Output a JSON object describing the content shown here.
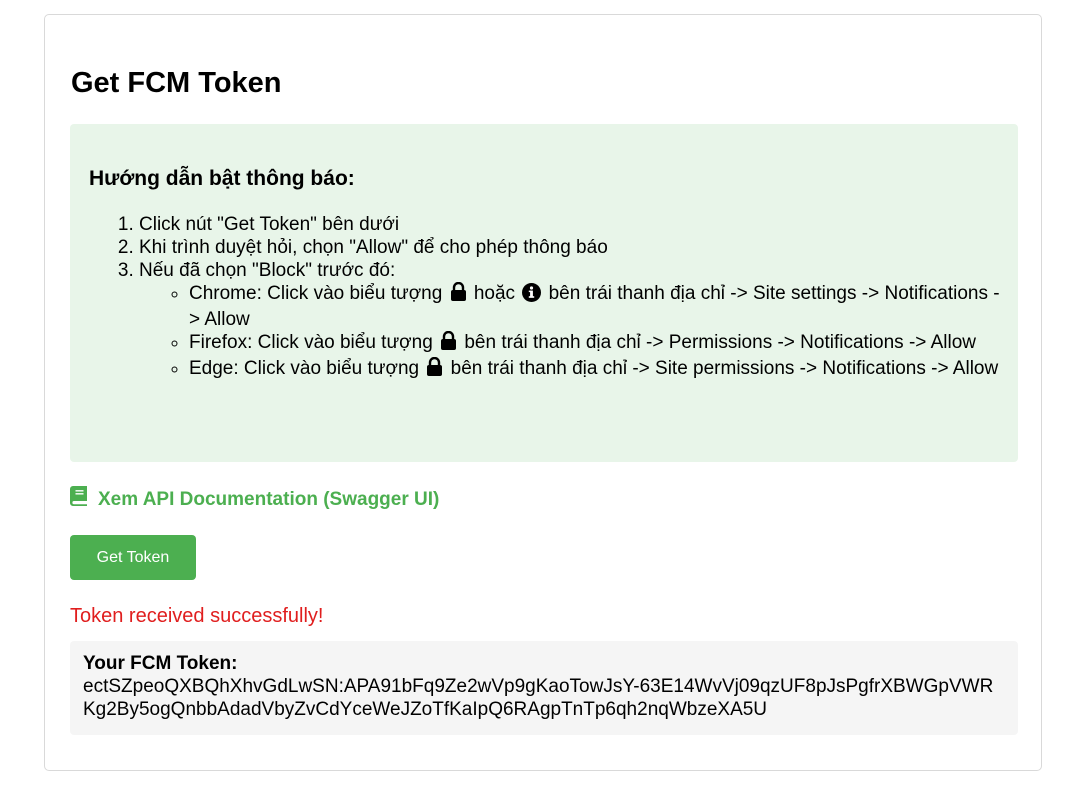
{
  "page": {
    "title": "Get FCM Token"
  },
  "guide": {
    "heading": "Hướng dẫn bật thông báo:",
    "step1": "Click nút \"Get Token\" bên dưới",
    "step2": "Khi trình duyệt hỏi, chọn \"Allow\" để cho phép thông báo",
    "step3": "Nếu đã chọn \"Block\" trước đó:",
    "chrome": {
      "before": "Chrome: Click vào biểu tượng",
      "middle": "hoặc",
      "after": "bên trái thanh địa chỉ -> Site settings -> Notifications -> Allow"
    },
    "firefox": {
      "before": "Firefox: Click vào biểu tượng",
      "after": "bên trái thanh địa chỉ -> Permissions -> Notifications -> Allow"
    },
    "edge": {
      "before": "Edge: Click vào biểu tượng",
      "after": "bên trái thanh địa chỉ -> Site permissions -> Notifications -> Allow"
    }
  },
  "doc_link": {
    "label": "Xem API Documentation (Swagger UI)",
    "icon": "book-icon"
  },
  "get_token_button": {
    "label": "Get Token"
  },
  "status": {
    "message": "Token received successfully!"
  },
  "token": {
    "label": "Your FCM Token:",
    "value": "ectSZpeoQXBQhXhvGdLwSN:APA91bFq9Ze2wVp9gKaoTowJsY-63E14WvVj09qzUF8pJsPgfrXBWGpVWRKg2By5ogQnbbAdadVbyZvCdYceWeJZoTfKaIpQ6RAgpTnTp6qh2nqWbzeXA5U"
  },
  "colors": {
    "accent": "#4caf50",
    "guide_bg": "#e8f5e9",
    "status": "#e01e1e",
    "token_bg": "#f5f5f5"
  }
}
